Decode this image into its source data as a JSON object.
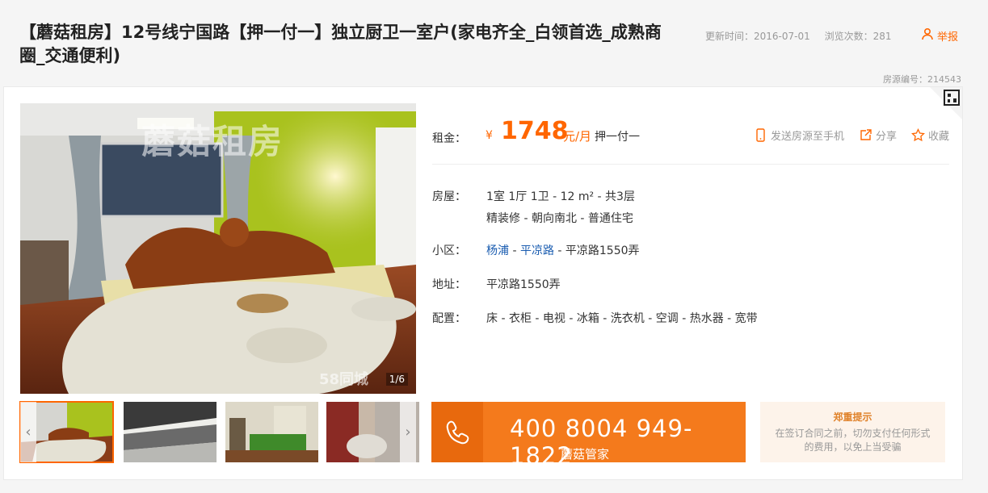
{
  "header": {
    "title": "【蘑菇租房】12号线宁国路【押一付一】独立厨卫一室户(家电齐全_白领首选_成熟商圈_交通便利)",
    "updated": "更新时间：2016-07-01",
    "views": "浏览次数：281",
    "report": "举报",
    "listing_no": "房源编号：214543"
  },
  "gallery": {
    "counter": "1/6",
    "watermark": "蘑菇租房",
    "watermark58": "58同城",
    "thumb_watermark": "58同城",
    "prev_icon": "chevron-left-icon",
    "next_icon": "chevron-right-icon",
    "thumbs": [
      "bedroom",
      "kitchen",
      "bedroom-green",
      "bathroom"
    ]
  },
  "price": {
    "label": "租金：",
    "currency": "¥",
    "amount": "1748",
    "unit": "元/月",
    "term": "押一付一"
  },
  "actions": {
    "send": "发送房源至手机",
    "share": "分享",
    "favorite": "收藏"
  },
  "details": {
    "house_label": "房屋：",
    "house_line1": "1室 1厅 1卫 - 12 m² - 共3层",
    "house_line2": "精装修 - 朝向南北 - 普通住宅",
    "community_label": "小区：",
    "community_district": "杨浦",
    "community_sep1": " - ",
    "community_area": "平凉路",
    "community_rest": " - 平凉路1550弄",
    "address_label": "地址：",
    "address": "平凉路1550弄",
    "amenities_label": "配置：",
    "amenities": "床 - 衣柜 - 电视 - 冰箱 - 洗衣机 - 空调 - 热水器 - 宽带"
  },
  "contact": {
    "phone": "400 8004 949-1822",
    "name": "蘑菇管家"
  },
  "tip": {
    "title": "郑重提示",
    "text": "在签订合同之前，切勿支付任何形式的费用，以免上当受骗"
  },
  "colors": {
    "accent": "#f60",
    "link": "#1a5cb0",
    "phone_bg": "#f47a1c"
  }
}
